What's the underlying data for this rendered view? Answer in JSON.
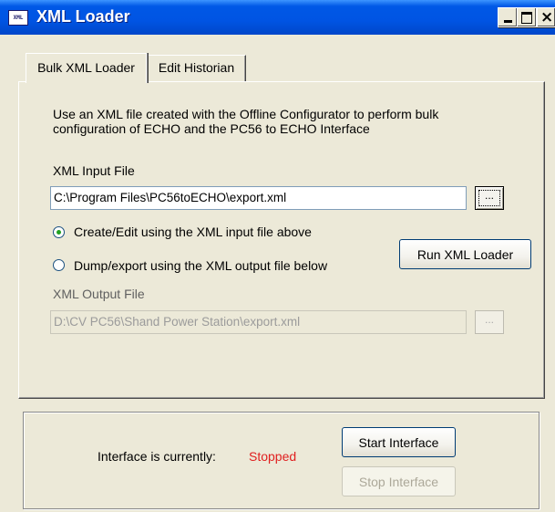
{
  "window": {
    "title": "XML Loader",
    "icon_text": "XML",
    "icon_name": "app-icon",
    "controls": [
      "minimize-icon",
      "maximize-icon",
      "close-icon"
    ]
  },
  "tabs": [
    {
      "label": "Bulk XML Loader",
      "active": true
    },
    {
      "label": "Edit Historian",
      "active": false
    }
  ],
  "bulk": {
    "description_line1": "Use an XML file created with the Offline Configurator  to perform bulk",
    "description_line2": "configuration of ECHO and the PC56 to ECHO Interface",
    "input_label": "XML Input File",
    "input_value": "C:\\Program Files\\PC56toECHO\\export.xml",
    "input_browse_label": "...",
    "radio_create_label": "Create/Edit using the XML input file above",
    "radio_dump_label": "Dump/export using the XML output file below",
    "selected_mode": "create",
    "run_button_label": "Run XML Loader",
    "output_label": "XML Output File",
    "output_value": "D:\\CV PC56\\Shand Power Station\\export.xml",
    "output_browse_label": "..."
  },
  "status": {
    "label": "Interface is currently:",
    "value": "Stopped",
    "value_color": "#e02020",
    "start_button_label": "Start Interface",
    "stop_button_label": "Stop Interface"
  }
}
